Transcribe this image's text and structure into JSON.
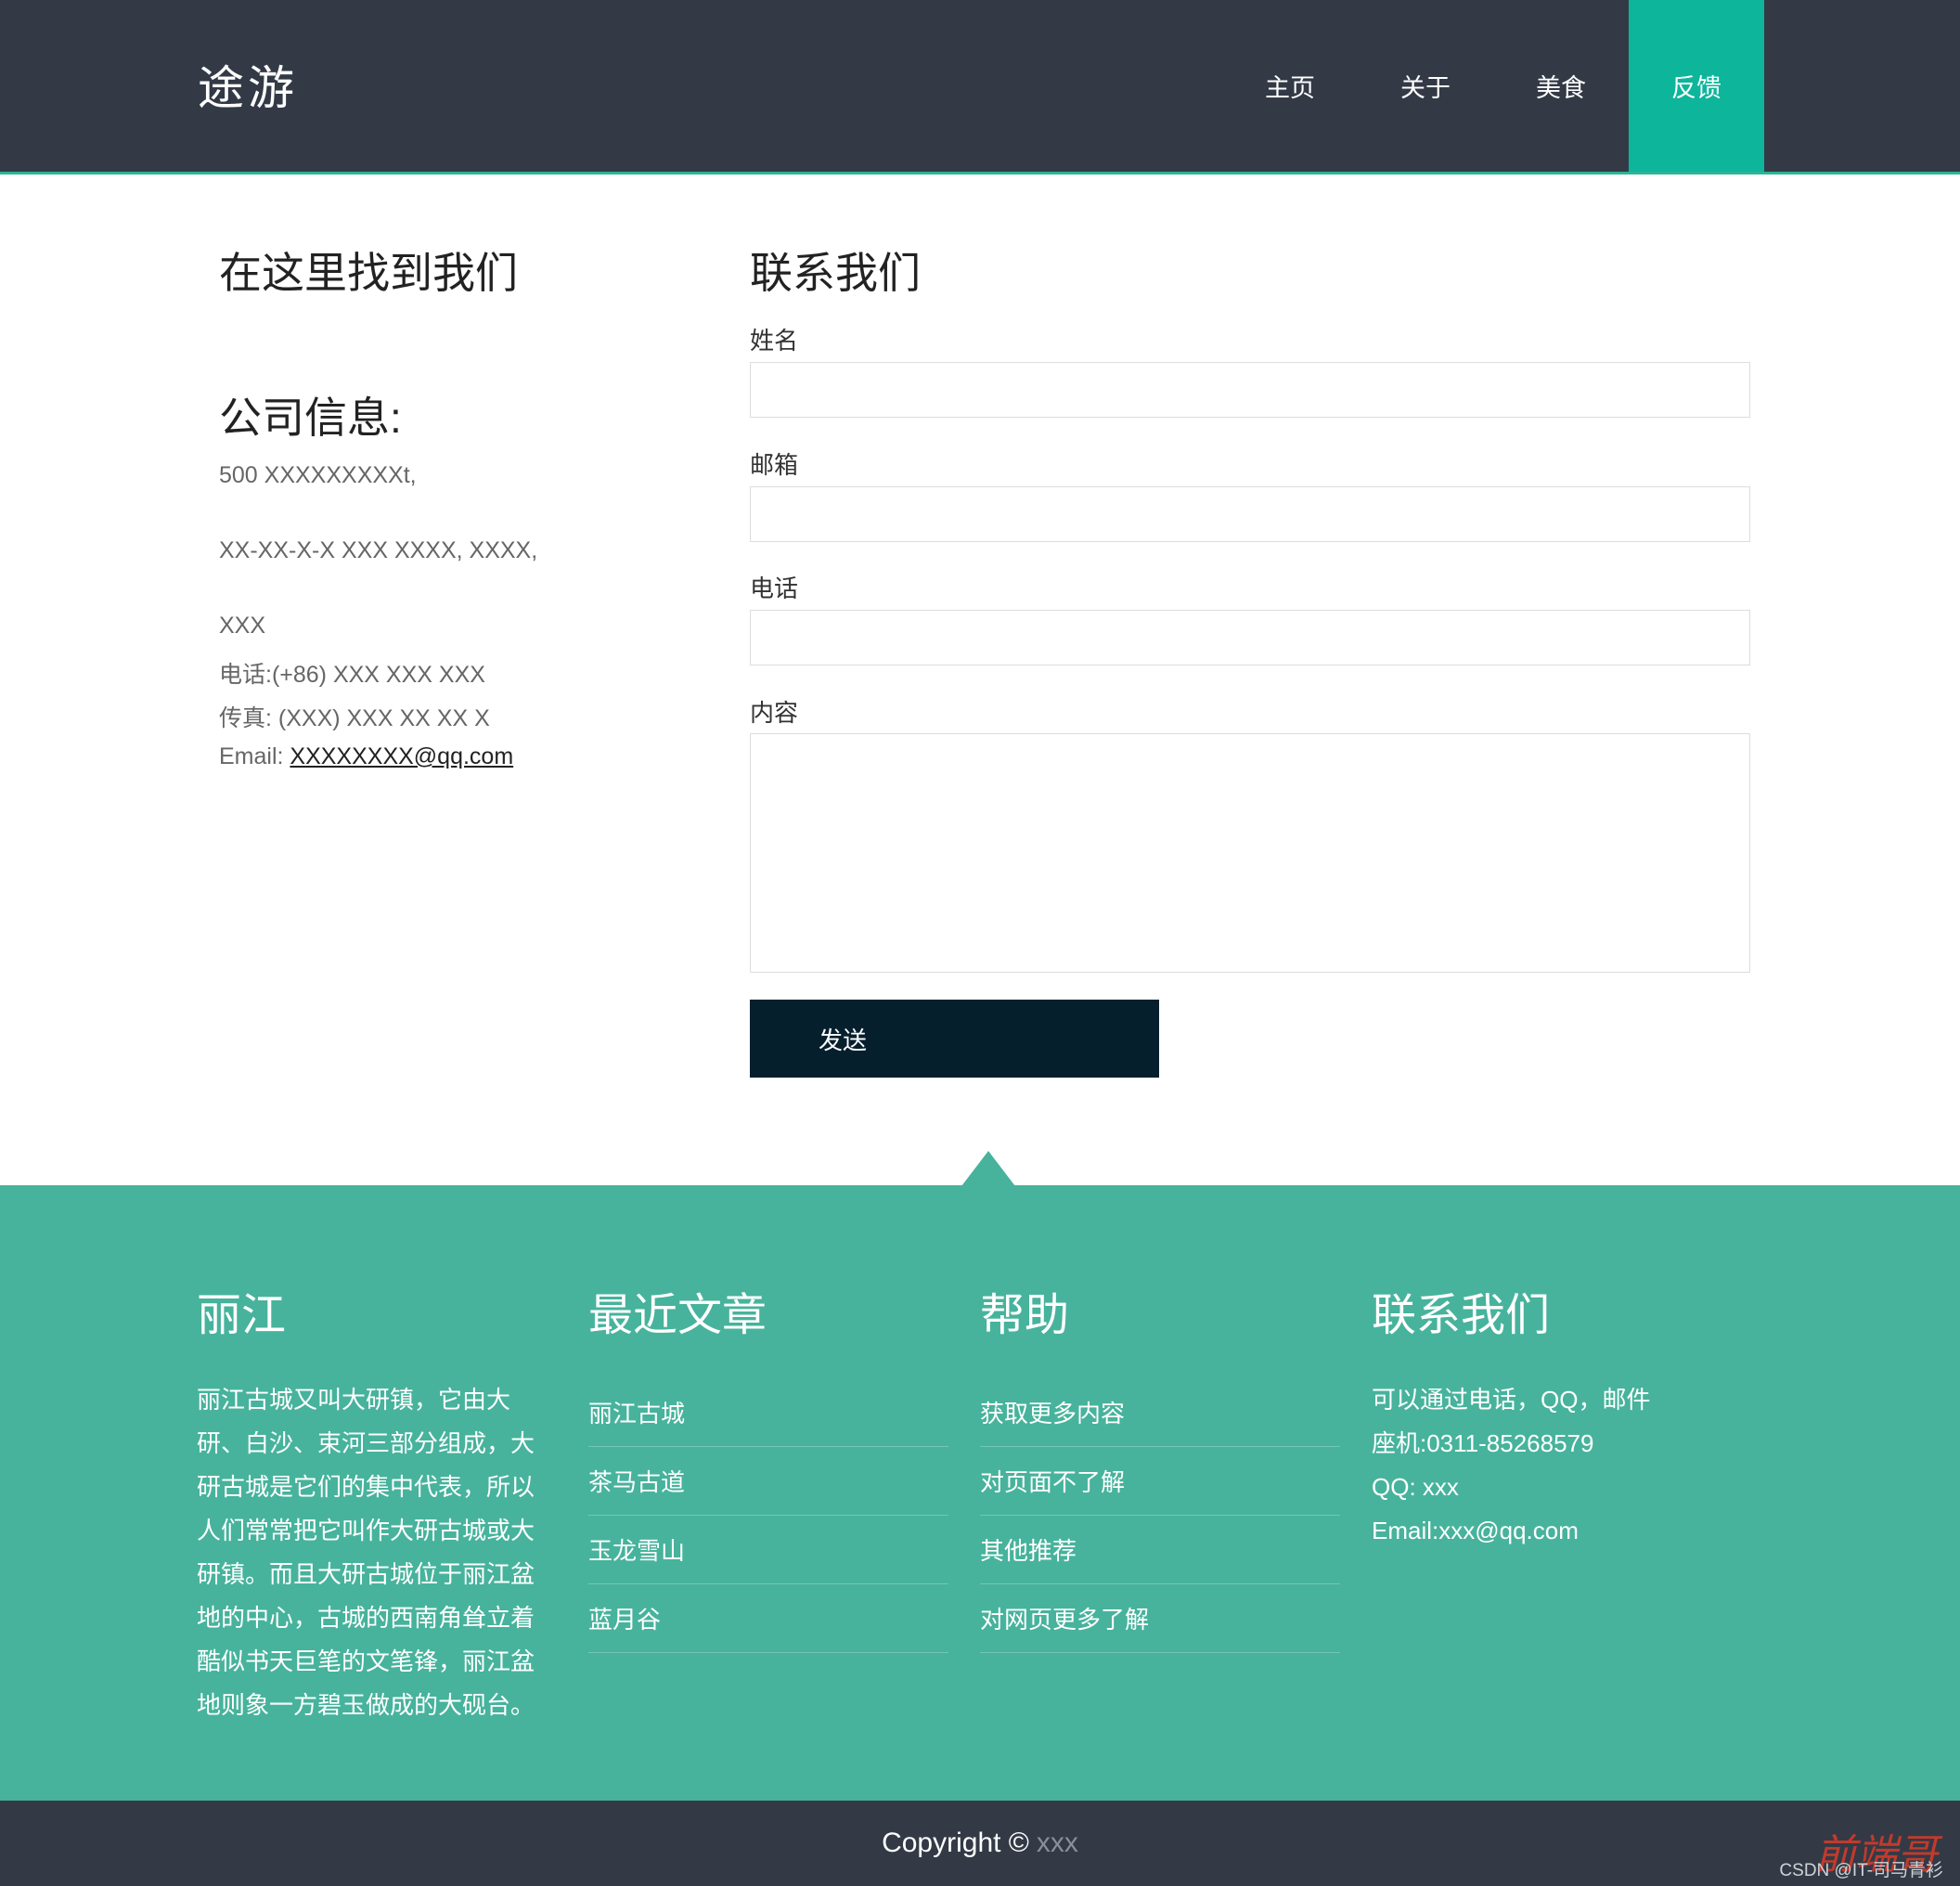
{
  "header": {
    "logo": "途游",
    "nav": [
      "主页",
      "关于",
      "美食",
      "反馈"
    ],
    "active_index": 3
  },
  "info": {
    "heading": "在这里找到我们",
    "company_title": "公司信息:",
    "address_line1": "500 XXXXXXXXXt,",
    "address_line2": "XX-XX-X-X XXX XXXX, XXXX,",
    "address_line3": "XXX",
    "phone": "电话:(+86) XXX XXX XXX",
    "fax": "传真: (XXX) XXX XX XX X",
    "email_label": "Email: ",
    "email_link": "XXXXXXXX@qq.com"
  },
  "contact": {
    "heading": "联系我们",
    "name_label": "姓名",
    "email_label": "邮箱",
    "phone_label": "电话",
    "content_label": "内容",
    "submit_label": "发送"
  },
  "footer": {
    "about": {
      "title": "丽江",
      "text": "丽江古城又叫大研镇，它由大研、白沙、束河三部分组成，大研古城是它们的集中代表，所以人们常常把它叫作大研古城或大研镇。而且大研古城位于丽江盆地的中心，古城的西南角耸立着酷似书天巨笔的文笔锋，丽江盆地则象一方碧玉做成的大砚台。"
    },
    "recent": {
      "title": "最近文章",
      "items": [
        "丽江古城",
        "茶马古道",
        "玉龙雪山",
        "蓝月谷"
      ]
    },
    "help": {
      "title": "帮助",
      "items": [
        "获取更多内容",
        "对页面不了解",
        "其他推荐",
        "对网页更多了解"
      ]
    },
    "contact": {
      "title": "联系我们",
      "line1": "可以通过电话，QQ，邮件",
      "line2": "座机:0311-85268579",
      "line3": "QQ: xxx",
      "line4": "Email:xxx@qq.com"
    }
  },
  "bottom": {
    "copyright": "Copyright ©",
    "owner": "xxx",
    "watermark_seal": "前端哥",
    "watermark_text": "CSDN @IT-司马青衫"
  },
  "colors": {
    "header_bg": "#333a46",
    "accent": "#0db59b",
    "footer_bg": "#47b39c",
    "button_bg": "#061f2d"
  }
}
